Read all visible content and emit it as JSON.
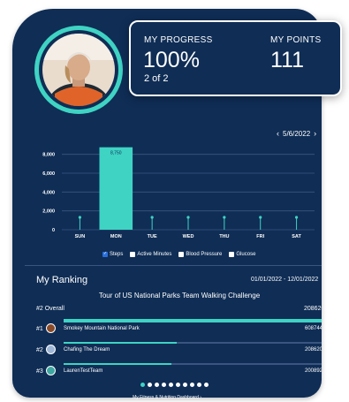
{
  "profile": {
    "avatar_icon": "user-photo"
  },
  "stats": {
    "progress_label": "MY PROGRESS",
    "progress_value": "100%",
    "progress_sub": "2 of 2",
    "points_label": "MY POINTS",
    "points_value": "111"
  },
  "date_nav": {
    "prev_label": "‹",
    "date": "5/6/2022",
    "next_label": "›"
  },
  "chart_data": {
    "type": "bar",
    "categories": [
      "SUN",
      "MON",
      "TUE",
      "WED",
      "THU",
      "FRI",
      "SAT"
    ],
    "series": [
      {
        "name": "Steps",
        "values": [
          0,
          8750,
          0,
          0,
          0,
          0,
          0
        ]
      }
    ],
    "data_labels": [
      "",
      "8,750",
      "",
      "",
      "",
      "",
      ""
    ],
    "yticks": [
      0,
      2000,
      4000,
      6000,
      8000
    ],
    "ytick_labels": [
      "0",
      "2,000",
      "4,000",
      "6,000",
      "8,000"
    ],
    "ylim": [
      0,
      9000
    ],
    "grid": true,
    "colors": {
      "bar": "#3fd3c3",
      "grid": "#3a5680",
      "text": "#ffffff"
    }
  },
  "legend": [
    {
      "label": "Steps",
      "checked": true
    },
    {
      "label": "Active Minutes",
      "checked": false
    },
    {
      "label": "Blood Pressure",
      "checked": false
    },
    {
      "label": "Glucose",
      "checked": false
    }
  ],
  "ranking": {
    "title": "My Ranking",
    "date_range": "01/01/2022 - 12/01/2022",
    "challenge_name": "Tour of US National Parks Team Walking Challenge",
    "overall_label": "#2 Overall",
    "overall_value": "208620",
    "teams": [
      {
        "rank": "#1",
        "name": "Smokey Mountain National Park",
        "value": "608744",
        "fill": 1.0
      },
      {
        "rank": "#2",
        "name": "Chafing The Dream",
        "value": "208620",
        "fill": 0.43
      },
      {
        "rank": "#3",
        "name": "LaurenTestTeam",
        "value": "200892",
        "fill": 0.41
      }
    ]
  },
  "pager": {
    "count": 10,
    "active": 0
  },
  "footer": {
    "link_label": "My Fitness & Nutrition Dashboard ›"
  },
  "colors": {
    "card": "#0f2d55",
    "accent": "#3fd3c3"
  }
}
